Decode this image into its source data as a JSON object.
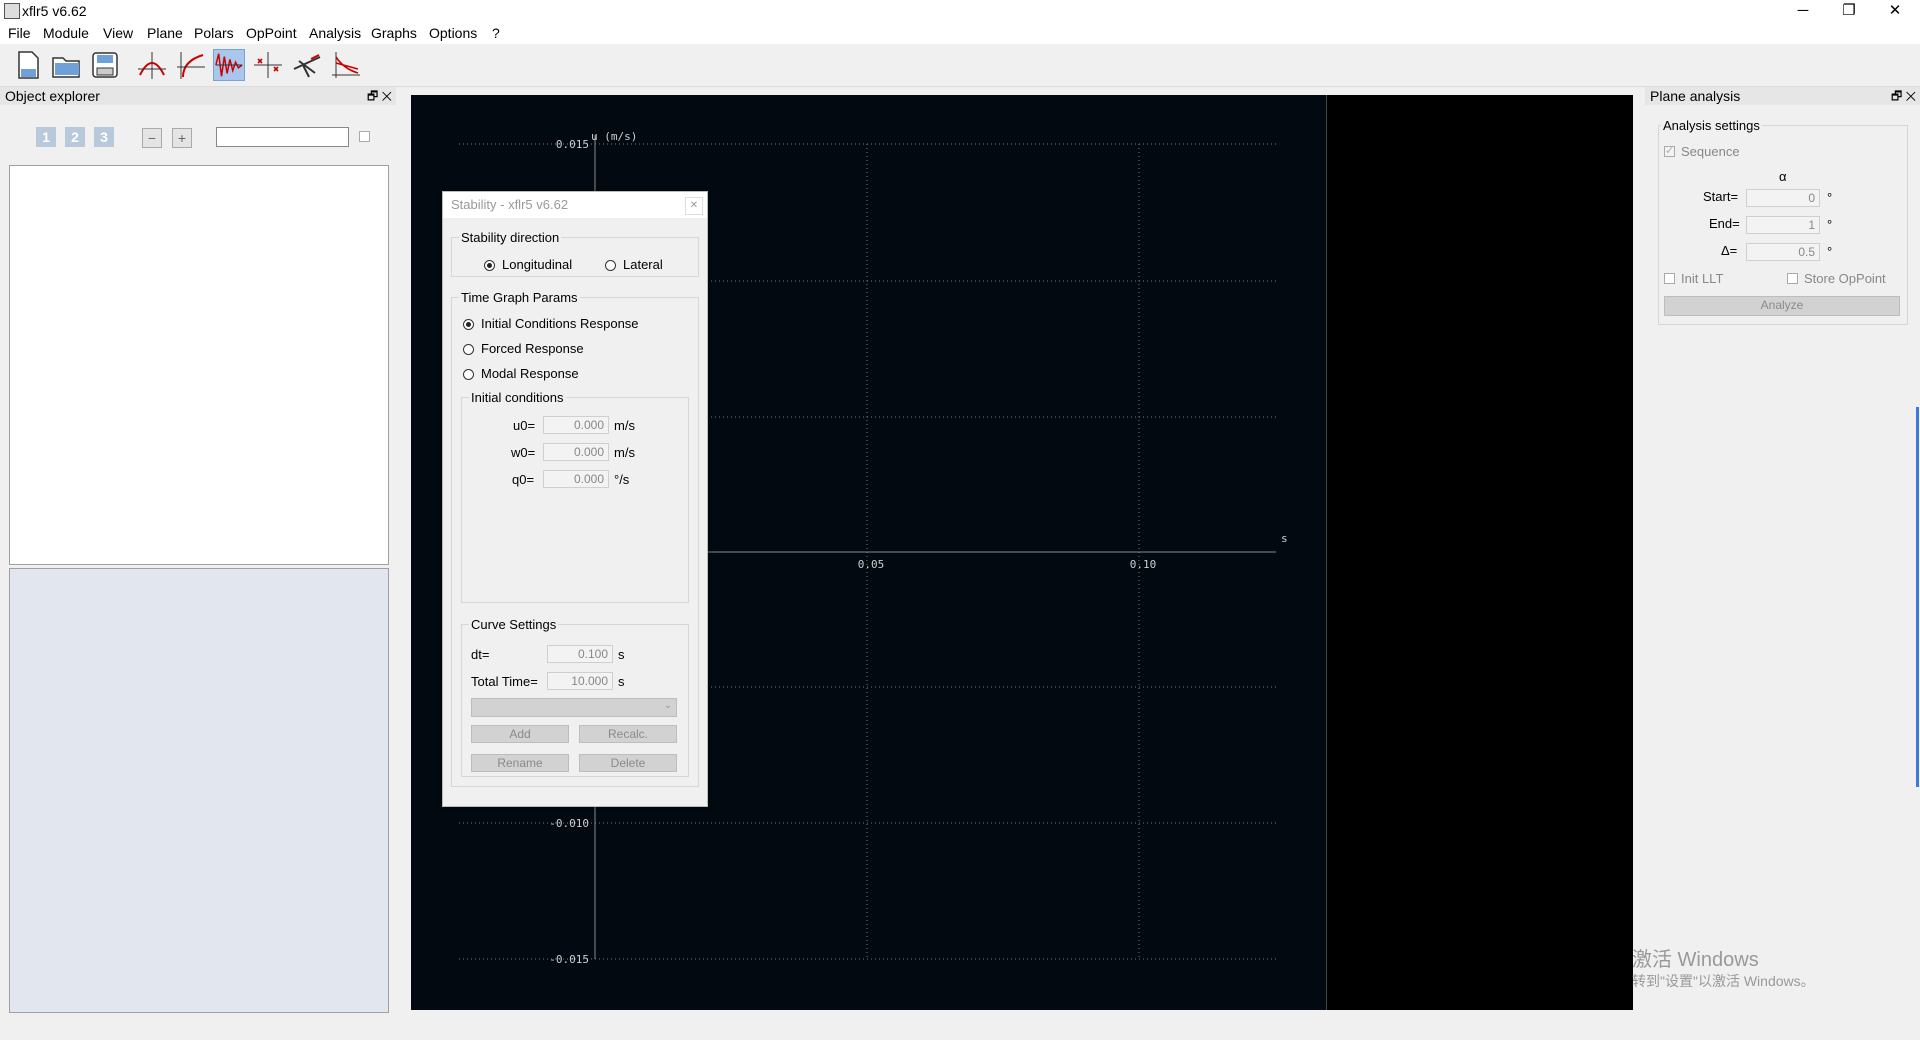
{
  "window": {
    "title": "xflr5 v6.62",
    "min": "─",
    "max": "❐",
    "close": "✕"
  },
  "menu": [
    "File",
    "Module",
    "View",
    "Plane",
    "Polars",
    "OpPoint",
    "Analysis",
    "Graphs",
    "Options",
    "?"
  ],
  "explorer": {
    "title": "Object explorer",
    "dock": "🗗 ✕",
    "btn1": "1",
    "btn2": "2",
    "btn3": "3",
    "minus": "−",
    "plus": "+",
    "search_value": ""
  },
  "graph": {
    "y_label": "u (m/s)",
    "x_label": "s",
    "y_ticks": [
      "0.015",
      "-0.010",
      "-0.015"
    ],
    "x_ticks": [
      "0.05",
      "0.10"
    ]
  },
  "dialog": {
    "title": "Stability - xflr5 v6.62",
    "close": "✕",
    "stability_direction": {
      "title": "Stability direction",
      "longitudinal": "Longitudinal",
      "lateral": "Lateral"
    },
    "time_graph": {
      "title": "Time Graph Params",
      "initial": "Initial Conditions Response",
      "forced": "Forced Response",
      "modal": "Modal Response"
    },
    "initial_conditions": {
      "title": "Initial conditions",
      "u0_label": "u0=",
      "u0_value": "0.000",
      "u0_unit": "m/s",
      "w0_label": "w0=",
      "w0_value": "0.000",
      "w0_unit": "m/s",
      "q0_label": "q0=",
      "q0_value": "0.000",
      "q0_unit": "°/s"
    },
    "curve_settings": {
      "title": "Curve Settings",
      "dt_label": "dt=",
      "dt_value": "0.100",
      "dt_unit": "s",
      "total_label": "Total Time=",
      "total_value": "10.000",
      "total_unit": "s",
      "add": "Add",
      "recalc": "Recalc.",
      "rename": "Rename",
      "delete": "Delete"
    }
  },
  "plane_analysis": {
    "title": "Plane analysis",
    "dock": "🗗 ✕",
    "settings_title": "Analysis settings",
    "sequence": "Sequence",
    "alpha": "α",
    "start_label": "Start=",
    "start_value": "0",
    "end_label": "End=",
    "end_value": "1",
    "delta_label": "Δ=",
    "delta_value": "0.5",
    "degree": "°",
    "init_llt": "Init LLT",
    "store_oppoint": "Store OpPoint",
    "analyze": "Analyze"
  },
  "watermark": {
    "line1": "激活 Windows",
    "line2": "转到\"设置\"以激活 Windows。"
  }
}
